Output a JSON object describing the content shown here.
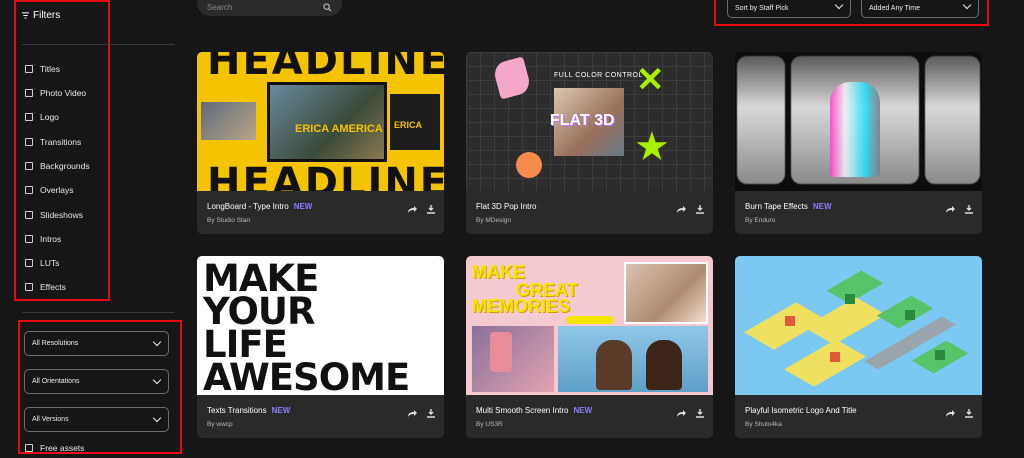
{
  "sidebar": {
    "filters_title": "Filters",
    "categories": [
      "Titles",
      "Photo Video",
      "Logo",
      "Transitions",
      "Backgrounds",
      "Overlays",
      "Slideshows",
      "Intros",
      "LUTs",
      "Effects"
    ],
    "selects": [
      "All Resolutions",
      "All Orientations",
      "All Versions"
    ],
    "free_assets": "Free assets"
  },
  "topbar": {
    "search_placeholder": "Search",
    "sort_label": "Sort by Staff Pick",
    "time_label": "Added Any Time"
  },
  "cards": [
    {
      "title": "LongBoard - Type Intro",
      "badge": "NEW",
      "author": "By Studio Stan"
    },
    {
      "title": "Flat 3D Pop Intro",
      "badge": "",
      "author": "By MDesign"
    },
    {
      "title": "Burn Tape Effects",
      "badge": "NEW",
      "author": "By Enduro"
    },
    {
      "title": "Texts Transitions",
      "badge": "NEW",
      "author": "By wwcp"
    },
    {
      "title": "Multi Smooth Screen Intro",
      "badge": "NEW",
      "author": "By US3R"
    },
    {
      "title": "Playful Isometric Logo And Title",
      "badge": "",
      "author": "By Shuto4ka"
    }
  ],
  "thumb_text": {
    "t1_headline": "HEADLINE",
    "t1_name": "ERICA AMERICA",
    "t1_name_side": "ERICA",
    "t2_header": "FULL COLOR CONTROL",
    "t2_label": "FLAT 3D",
    "t4_lines": [
      "MAKE",
      "YOUR",
      "LIFE",
      "AWESOME"
    ],
    "t5_lines": [
      "MAKE",
      "GREAT",
      "MEMORIES"
    ]
  },
  "colors": {
    "accent_badge": "#8a7dff",
    "highlight": "#e50914"
  }
}
